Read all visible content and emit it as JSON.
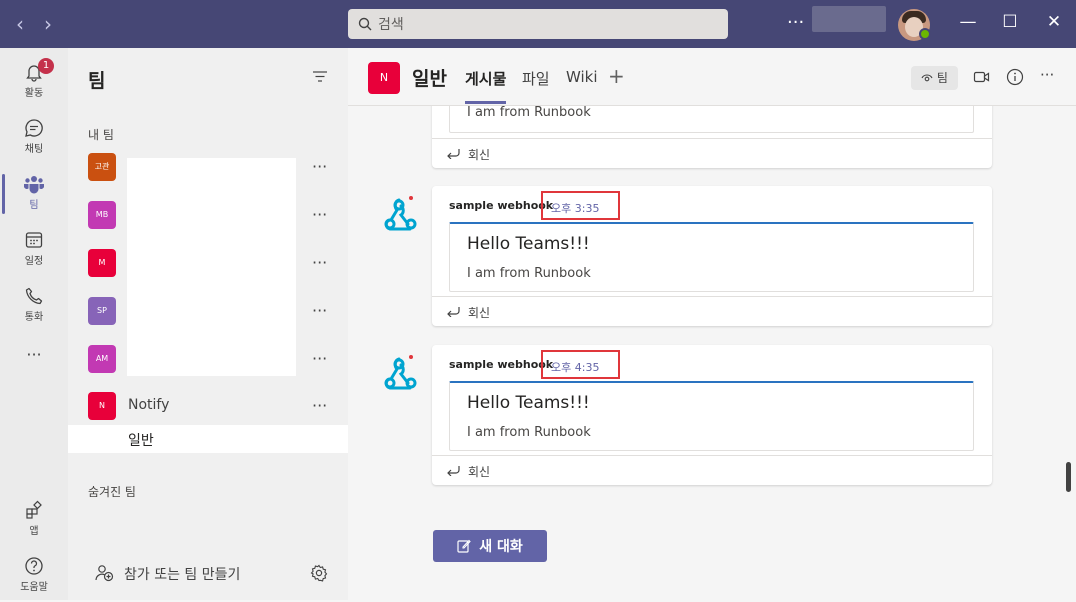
{
  "titlebar": {
    "search_placeholder": "검색",
    "more": "···",
    "win_min": "—",
    "win_max": "☐",
    "win_close": "✕",
    "back": "‹",
    "forward": "›"
  },
  "rail": {
    "activity": {
      "label": "활동",
      "badge": "1"
    },
    "chat": {
      "label": "채팅"
    },
    "teams": {
      "label": "팀"
    },
    "calendar": {
      "label": "일정"
    },
    "calls": {
      "label": "통화"
    },
    "more": "···",
    "apps": {
      "label": "앱"
    },
    "help": {
      "label": "도움말"
    }
  },
  "teams_panel": {
    "title": "팀",
    "my_teams": "내 팀",
    "teams": [
      {
        "initials": "고관",
        "color": "#ca5010",
        "name": ""
      },
      {
        "initials": "MB",
        "color": "#c239b3",
        "name": ""
      },
      {
        "initials": "M",
        "color": "#e8003a",
        "name": ""
      },
      {
        "initials": "SP",
        "color": "#8764b8",
        "name": ""
      },
      {
        "initials": "AM",
        "color": "#c239b3",
        "name": ""
      },
      {
        "initials": "N",
        "color": "#e8003a",
        "name": "Notify"
      }
    ],
    "channel": "일반",
    "hidden_teams": "숨겨진 팀",
    "join_create": "참가 또는 팀 만들기",
    "dots": "···"
  },
  "header": {
    "team_initial": "N",
    "channel": "일반",
    "tabs": [
      "게시물",
      "파일",
      "Wiki"
    ],
    "add_tab": "+",
    "team_btn": "팀",
    "more": "···"
  },
  "posts": [
    {
      "sender": "",
      "time": "",
      "title": "",
      "body": "I am from Runbook",
      "reply": "회신"
    },
    {
      "sender": "sample webhook",
      "time": "오후 3:35",
      "title": "Hello Teams!!!",
      "body": "I am from Runbook",
      "reply": "회신"
    },
    {
      "sender": "sample webhook",
      "time": "오후 4:35",
      "title": "Hello Teams!!!",
      "body": "I am from Runbook",
      "reply": "회신"
    }
  ],
  "new_conversation": "새 대화",
  "colors": {
    "accent": "#6264a7",
    "titlebar": "#464775",
    "highlight": "#e0363b"
  }
}
